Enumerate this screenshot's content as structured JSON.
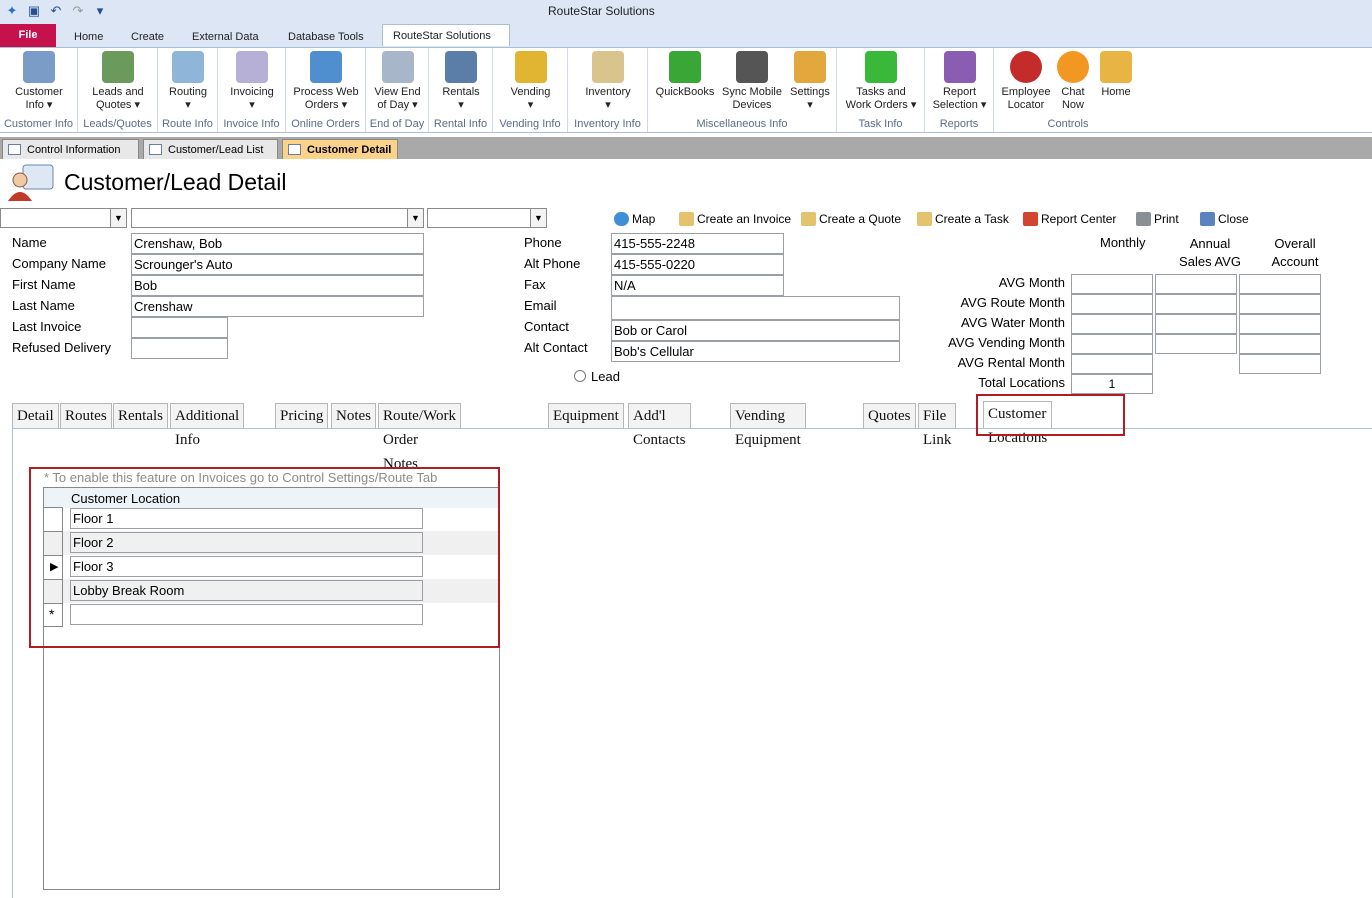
{
  "app": {
    "title": "RouteStar Solutions"
  },
  "ribbon_tabs": [
    "File",
    "Home",
    "Create",
    "External Data",
    "Database Tools",
    "RouteStar Solutions"
  ],
  "ribbon": {
    "customer_info": {
      "label": "Customer\nInfo ▾",
      "group": "Customer Info"
    },
    "leads_quotes": {
      "label": "Leads and\nQuotes ▾",
      "group": "Leads/Quotes"
    },
    "routing": {
      "label": "Routing\n▾",
      "group": "Route Info"
    },
    "invoicing": {
      "label": "Invoicing\n▾",
      "group": "Invoice Info"
    },
    "process_web": {
      "label": "Process Web\nOrders ▾",
      "group": "Online Orders"
    },
    "view_eod": {
      "label": "View End\nof Day ▾",
      "group": "End of Day"
    },
    "rentals": {
      "label": "Rentals\n▾",
      "group": "Rental Info"
    },
    "vending": {
      "label": "Vending\n▾",
      "group": "Vending Info"
    },
    "inventory": {
      "label": "Inventory\n▾",
      "group": "Inventory Info"
    },
    "quickbooks": {
      "label": "QuickBooks"
    },
    "sync_mobile": {
      "label": "Sync Mobile\nDevices"
    },
    "settings": {
      "label": "Settings\n▾"
    },
    "misc_group": "Miscellaneous Info",
    "tasks": {
      "label": "Tasks and\nWork Orders ▾",
      "group": "Task Info"
    },
    "report_selection": {
      "label": "Report\nSelection ▾",
      "group": "Reports"
    },
    "employee_locator": {
      "label": "Employee\nLocator"
    },
    "chat_now": {
      "label": "Chat\nNow"
    },
    "home": {
      "label": "Home"
    },
    "controls_group": "Controls"
  },
  "doc_tabs": [
    "Control Information",
    "Customer/Lead List",
    "Customer Detail"
  ],
  "header": {
    "title": "Customer/Lead Detail"
  },
  "actions": {
    "map": "Map",
    "create_invoice": "Create an Invoice",
    "create_quote": "Create a Quote",
    "create_task": "Create a Task",
    "report_center": "Report Center",
    "print": "Print",
    "close": "Close"
  },
  "fields": {
    "name": {
      "label": "Name",
      "value": "Crenshaw, Bob"
    },
    "company": {
      "label": "Company Name",
      "value": "Scrounger's Auto"
    },
    "first": {
      "label": "First Name",
      "value": "Bob"
    },
    "last": {
      "label": "Last Name",
      "value": "Crenshaw"
    },
    "last_invoice": {
      "label": "Last Invoice",
      "value": ""
    },
    "refused": {
      "label": "Refused Delivery",
      "value": ""
    },
    "phone": {
      "label": "Phone",
      "value": "415-555-2248"
    },
    "alt_phone": {
      "label": "Alt Phone",
      "value": "415-555-0220"
    },
    "fax": {
      "label": "Fax",
      "value": "N/A"
    },
    "email": {
      "label": "Email",
      "value": ""
    },
    "contact": {
      "label": "Contact",
      "value": "Bob or Carol"
    },
    "alt_contact": {
      "label": "Alt Contact",
      "value": "Bob's Cellular"
    },
    "lead": {
      "label": "Lead"
    }
  },
  "stats": {
    "col_monthly": "Monthly",
    "col_annual": "Annual\nSales AVG",
    "col_overall": "Overall\nAccount",
    "rows": [
      "AVG Month",
      "AVG Route Month",
      "AVG Water Month",
      "AVG Vending Month",
      "AVG Rental Month",
      "Total Locations"
    ],
    "total_locations": "1"
  },
  "form_tabs": [
    "Detail",
    "Routes",
    "Rentals",
    "Additional Info",
    "Pricing",
    "Notes",
    "Route/Work Order Notes",
    "Equipment",
    "Add'l Contacts",
    "Vending Equipment",
    "Quotes",
    "File Link",
    "Customer Locations"
  ],
  "locations": {
    "note": "* To enable this feature on Invoices go to Control Settings/Route Tab",
    "column": "Customer Location",
    "rows": [
      "Floor 1",
      "Floor 2",
      "Floor 3",
      "Lobby Break Room"
    ]
  }
}
